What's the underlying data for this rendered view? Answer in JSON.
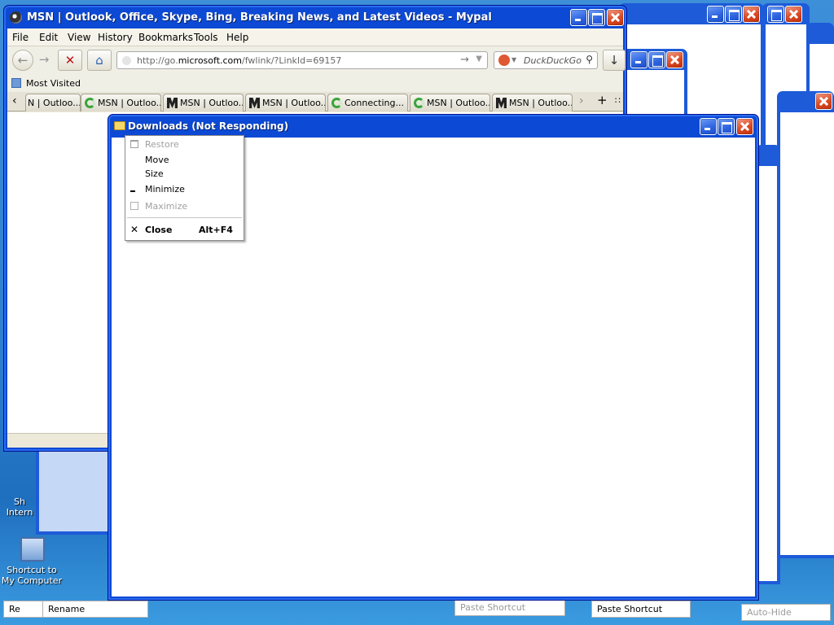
{
  "firefox": {
    "title": "MSN | Outlook, Office, Skype, Bing, Breaking News, and Latest Videos - Mypal",
    "menu": [
      "File",
      "Edit",
      "View",
      "History",
      "Bookmarks",
      "Tools",
      "Help"
    ],
    "url_prefix": "http://go.",
    "url_domain": "microsoft.com",
    "url_suffix": "/fwlink/?LinkId=69157",
    "search_placeholder": "DuckDuckGo",
    "bookmarks_label": "Most Visited",
    "tabs": [
      {
        "label": "N | Outloo...",
        "icon": "none"
      },
      {
        "label": "MSN | Outloo...",
        "icon": "spinner"
      },
      {
        "label": "MSN | Outloo...",
        "icon": "msn"
      },
      {
        "label": "MSN | Outloo...",
        "icon": "msn"
      },
      {
        "label": "Connecting...",
        "icon": "spinner"
      },
      {
        "label": "MSN | Outloo...",
        "icon": "spinner"
      },
      {
        "label": "MSN | Outloo...",
        "icon": "msn"
      }
    ]
  },
  "downloads": {
    "title": "Downloads (Not Responding)"
  },
  "sysmenu": {
    "items": [
      {
        "label": "Restore",
        "accel": "",
        "disabled": true,
        "icon": "restore-icon"
      },
      {
        "label": "Move",
        "accel": "",
        "disabled": false,
        "icon": ""
      },
      {
        "label": "Size",
        "accel": "",
        "disabled": false,
        "icon": ""
      },
      {
        "label": "Minimize",
        "accel": "",
        "disabled": false,
        "icon": "minimize-icon"
      },
      {
        "label": "Maximize",
        "accel": "",
        "disabled": true,
        "icon": "maximize-icon"
      },
      {
        "label": "Close",
        "accel": "Alt+F4",
        "disabled": false,
        "icon": "close-icon"
      }
    ]
  },
  "desktop": {
    "icon1_label_a": "Sh",
    "icon1_label_b": "Intern",
    "icon2_label": "Shortcut to My Computer"
  },
  "bottom": {
    "re": "Re",
    "rename": "Rename",
    "paste1": "Paste Shortcut",
    "paste2": "Paste Shortcut",
    "autohide": "Auto-Hide"
  }
}
